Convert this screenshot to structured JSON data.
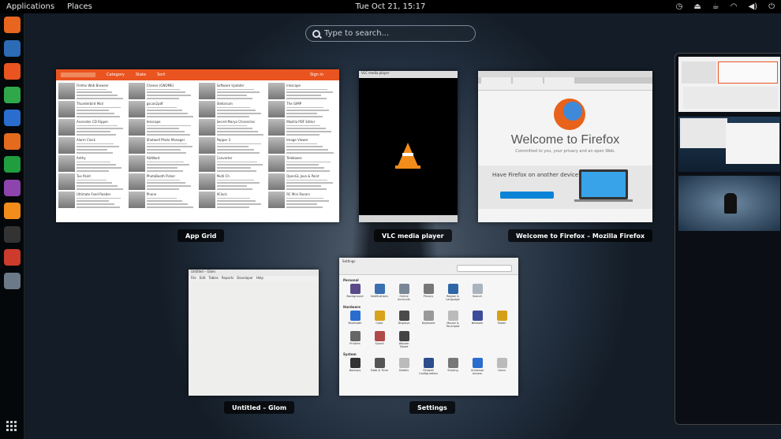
{
  "topbar": {
    "applications": "Applications",
    "places": "Places",
    "clock": "Tue Oct 21, 15:17",
    "tray": [
      "status-icon",
      "eject-icon",
      "coffee-icon",
      "wifi-icon",
      "volume-icon",
      "power-icon"
    ]
  },
  "search": {
    "placeholder": "Type to search..."
  },
  "dash": {
    "items": [
      {
        "name": "firefox-icon",
        "color": "#e8651f"
      },
      {
        "name": "thunderbird-icon",
        "color": "#2c6bb5"
      },
      {
        "name": "app-grid-icon",
        "color": "#e95420"
      },
      {
        "name": "leaf-icon",
        "color": "#2fa84a"
      },
      {
        "name": "writer-icon",
        "color": "#2a6dcf"
      },
      {
        "name": "impress-icon",
        "color": "#e46a1e"
      },
      {
        "name": "calc-icon",
        "color": "#1f9d3f"
      },
      {
        "name": "math-icon",
        "color": "#8e44ad"
      },
      {
        "name": "vlc-icon",
        "color": "#f28c1b"
      },
      {
        "name": "ubuntu-icon",
        "color": "#333333"
      },
      {
        "name": "settings-icon",
        "color": "#cc3b2b"
      },
      {
        "name": "files-icon",
        "color": "#6b7a89"
      }
    ],
    "show_apps_icon": "grid-icon"
  },
  "windows": {
    "app_grid": {
      "label": "App Grid",
      "tabs": [
        "Category",
        "State",
        "Sort"
      ],
      "signin": "Sign in",
      "apps": [
        "Firefox Web Browser",
        "Cheese (GNOME)",
        "Software Updater",
        "Inkscape",
        "Thunderbird Mail",
        "gscan2pdf",
        "Stellarium",
        "The GIMP",
        "Ascender CD Ripper",
        "Inkscape",
        "Secret Maryo Chronicles",
        "Mozilla PDF Editor",
        "Alarm Clock",
        "Shotwell Photo Manager",
        "Pepper 3",
        "Image Viewer",
        "Anthy",
        "AbiWord",
        "Converter",
        "Teleboxes",
        "Tux Paint",
        "PhotoBooth Picker",
        "Multi Ch",
        "OpenGL Java & Paint",
        "Ultimate Feed Reader",
        "Phone",
        "XClock",
        "RC Mini Racers"
      ]
    },
    "vlc": {
      "label": "VLC media player",
      "menu": "VLC media player"
    },
    "firefox": {
      "label": "Welcome to Firefox – Mozilla Firefox",
      "welcome": "Welcome to Firefox",
      "sub": "Committed to you, your privacy and an open Web.",
      "question": "Have Firefox on another device?"
    },
    "glom": {
      "label": "Untitled – Glom",
      "title": "Untitled – Glom",
      "menu": [
        "File",
        "Edit",
        "Tables",
        "Reports",
        "Developer",
        "Help"
      ]
    },
    "settings": {
      "label": "Settings",
      "title": "Settings",
      "sections": [
        {
          "title": "Personal",
          "items": [
            {
              "label": "Background",
              "color": "#5b4a8a"
            },
            {
              "label": "Notifications",
              "color": "#3a6fb0"
            },
            {
              "label": "Online Accounts",
              "color": "#7a8796"
            },
            {
              "label": "Privacy",
              "color": "#777777"
            },
            {
              "label": "Region & Language",
              "color": "#2f66a8"
            },
            {
              "label": "Search",
              "color": "#aab4be"
            }
          ]
        },
        {
          "title": "Hardware",
          "items": [
            {
              "label": "Bluetooth",
              "color": "#2a6dcf"
            },
            {
              "label": "Color",
              "color": "#d9a21b"
            },
            {
              "label": "Displays",
              "color": "#4a4a4a"
            },
            {
              "label": "Keyboard",
              "color": "#999999"
            },
            {
              "label": "Mouse & Touchpad",
              "color": "#bbbbbb"
            },
            {
              "label": "Network",
              "color": "#3d4c9a"
            },
            {
              "label": "Power",
              "color": "#d4a017"
            }
          ]
        },
        {
          "title": "",
          "items": [
            {
              "label": "Printers",
              "color": "#666666"
            },
            {
              "label": "Sound",
              "color": "#b04a4a"
            },
            {
              "label": "Wacom Tablet",
              "color": "#444444"
            }
          ]
        },
        {
          "title": "System",
          "items": [
            {
              "label": "Backups",
              "color": "#333333"
            },
            {
              "label": "Date & Time",
              "color": "#555555"
            },
            {
              "label": "Details",
              "color": "#bbbbbb"
            },
            {
              "label": "Firewall Configuration",
              "color": "#2b4d8c"
            },
            {
              "label": "Sharing",
              "color": "#777777"
            },
            {
              "label": "Universal Access",
              "color": "#2a6dcf"
            },
            {
              "label": "Users",
              "color": "#bbbbbb"
            }
          ]
        }
      ]
    }
  }
}
